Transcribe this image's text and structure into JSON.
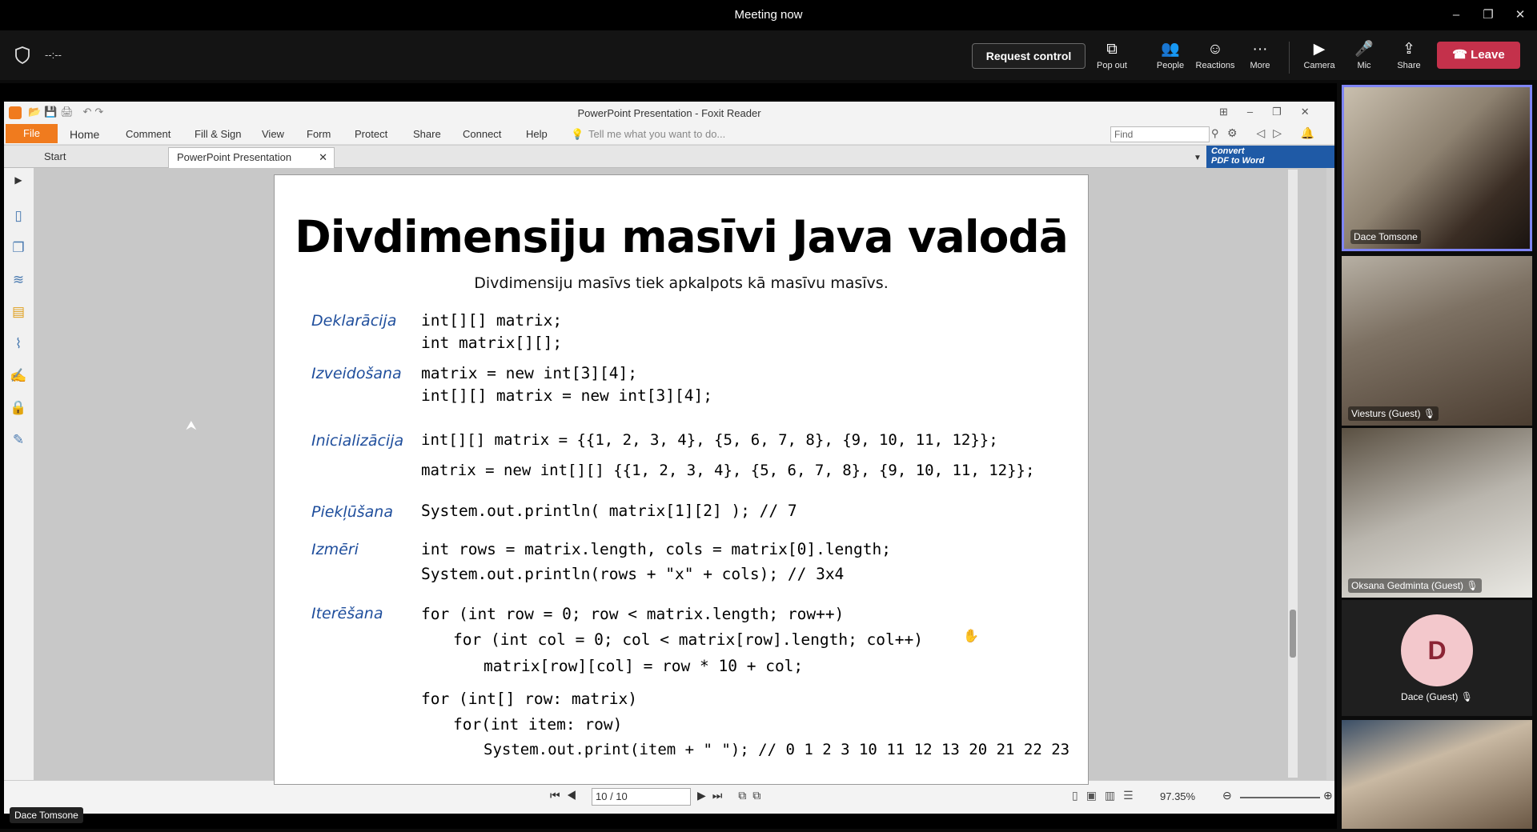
{
  "window": {
    "title": "Meeting now",
    "controls": [
      "–",
      "❐",
      "✕"
    ]
  },
  "meeting_toolbar": {
    "timer": "--:--",
    "request_control": "Request control",
    "buttons": [
      {
        "label": "Pop out",
        "icon": "pop-out-icon"
      },
      {
        "label": "People",
        "icon": "people-icon"
      },
      {
        "label": "Reactions",
        "icon": "reactions-icon"
      },
      {
        "label": "More",
        "icon": "more-icon"
      },
      {
        "label": "Camera",
        "icon": "camera-icon"
      },
      {
        "label": "Mic",
        "icon": "mic-off-icon"
      },
      {
        "label": "Share",
        "icon": "share-icon"
      }
    ],
    "leave": "Leave",
    "leave_color": "#c4314b"
  },
  "foxit": {
    "title": "PowerPoint Presentation - Foxit Reader",
    "menu": [
      "File",
      "Home",
      "Comment",
      "Fill & Sign",
      "View",
      "Form",
      "Protect",
      "Share",
      "Connect",
      "Help"
    ],
    "tell_me": "Tell me what you want to do...",
    "find_placeholder": "Find",
    "tabs": [
      "Start",
      "PowerPoint Presentation"
    ],
    "convert_banner": [
      "Convert",
      "PDF to Word"
    ],
    "status": {
      "page": "10 / 10",
      "zoom": "97.35%"
    }
  },
  "slide": {
    "title": "Divdimensiju masīvi Java valodā",
    "subtitle": "Divdimensiju masīvs tiek apkalpots kā masīvu masīvs.",
    "labels": {
      "decl": "Deklarācija",
      "create": "Izveidošana",
      "init": "Inicializācija",
      "access": "Piekļūšana",
      "size": "Izmēri",
      "iter": "Iterēšana"
    },
    "code": {
      "decl1": "int[][] matrix;",
      "decl2": "int matrix[][];",
      "create1": "matrix = new int[3][4];",
      "create2": "int[][] matrix = new int[3][4];",
      "init1": "int[][] matrix = {{1, 2, 3, 4}, {5, 6, 7, 8}, {9, 10, 11, 12}};",
      "init2": "matrix = new int[][] {{1, 2, 3, 4}, {5, 6, 7, 8}, {9, 10, 11, 12}};",
      "access1": "System.out.println( matrix[1][2] ); // 7",
      "size1": "int rows = matrix.length, cols = matrix[0].length;",
      "size2": "System.out.println(rows + \"x\" + cols); // 3x4",
      "iter1": "for (int row = 0; row < matrix.length; row++)",
      "iter2": "for (int col = 0; col < matrix[row].length; col++)",
      "iter3": "matrix[row][col] = row * 10 + col;",
      "iter4": "for (int[] row: matrix)",
      "iter5": "for(int item: row)",
      "iter6": "System.out.print(item + \" \"); // 0 1 2 3 10 11 12 13 20 21 22 23"
    }
  },
  "presenter_label": "Dace Tomsone",
  "participants": [
    {
      "name": "Dace Tomsone",
      "muted": false,
      "active": true
    },
    {
      "name": "Viesturs (Guest)",
      "muted": true
    },
    {
      "name": "Oksana Gedminta (Guest)",
      "muted": true
    },
    {
      "name": "Dace (Guest)",
      "muted": true,
      "initial": "D"
    },
    {
      "name": "",
      "muted": false
    }
  ]
}
